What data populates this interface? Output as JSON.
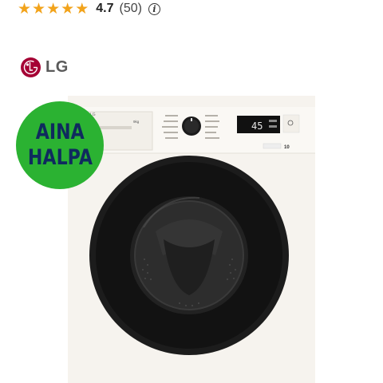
{
  "rating": {
    "stars": 5,
    "value": "4.7",
    "count": "(50)",
    "info_icon": "info-icon"
  },
  "brand": {
    "name": "LG",
    "logo": "lg-logo",
    "color": "#a50034"
  },
  "badge": {
    "line1": "AINA",
    "line2": "HALPA",
    "color": "#2bb232"
  },
  "product": {
    "display": "45",
    "logo_text": "LG",
    "capacity": "9kg",
    "energy_label": "10"
  }
}
